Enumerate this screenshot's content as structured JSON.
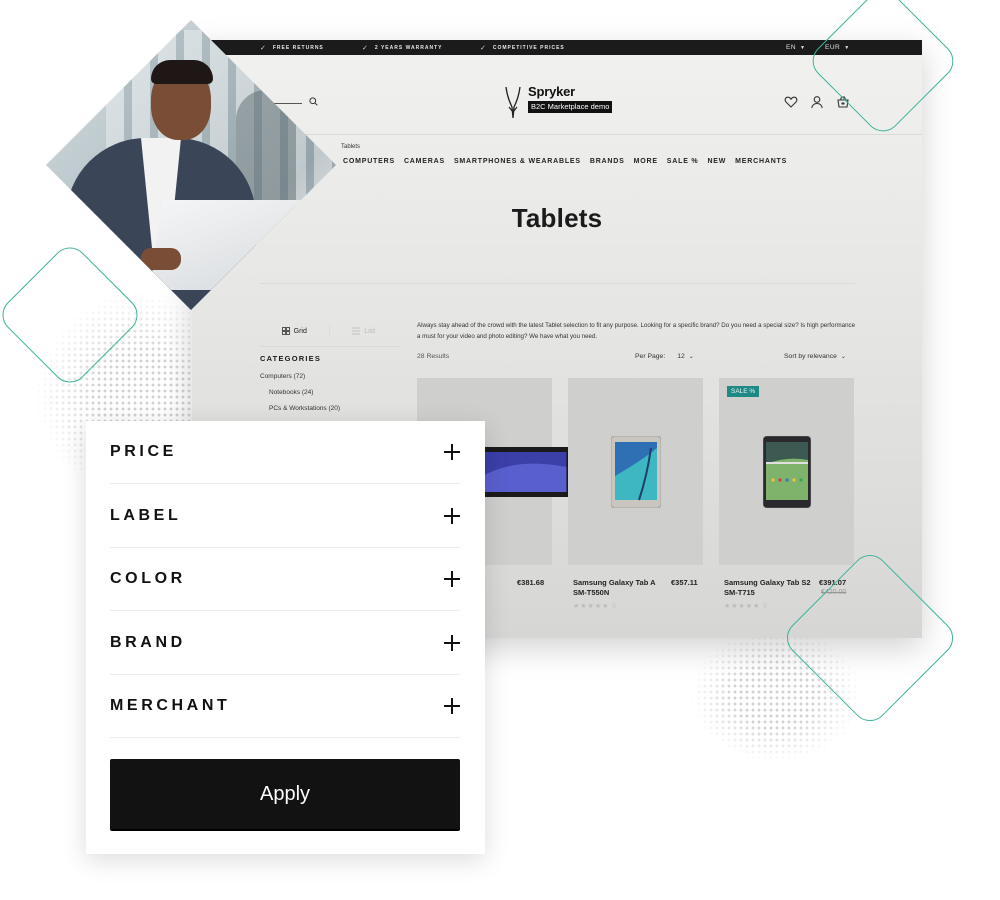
{
  "topbar": {
    "promos": [
      "Free Returns",
      "2 Years Warranty",
      "Competitive Prices"
    ],
    "language": "EN",
    "currency": "EUR"
  },
  "header": {
    "brand_name": "Spryker",
    "brand_subtitle": "B2C Marketplace demo",
    "icons": [
      "search-icon",
      "heart-icon",
      "user-icon",
      "cart-icon"
    ]
  },
  "nav": {
    "items": [
      "Computers",
      "Cameras",
      "Smartphones & Wearables",
      "Brands",
      "More",
      "Sale %",
      "New",
      "Merchants"
    ]
  },
  "breadcrumb": {
    "current": "Tablets"
  },
  "page": {
    "title": "Tablets",
    "description": "Always stay ahead of the crowd with the latest Tablet selection to fit any purpose. Looking for a specific brand? Do you need a special size? Is high performance a must for your video and photo editing? We have what you need.",
    "results": "28 Results",
    "per_page_label": "Per Page:",
    "per_page_value": "12",
    "sort_label": "Sort by relevance"
  },
  "view_toggle": {
    "grid": "Grid",
    "list": "List"
  },
  "categories": {
    "title": "Categories",
    "items": [
      {
        "label": "Computers (72)",
        "level": 0
      },
      {
        "label": "Notebooks (24)",
        "level": 1
      },
      {
        "label": "PCs & Workstations (20)",
        "level": 1
      }
    ]
  },
  "products": [
    {
      "name": "",
      "price": "€381.68",
      "old_price": "",
      "badge": "",
      "rating": 0
    },
    {
      "name": "Samsung Galaxy Tab A SM-T550N",
      "price": "€357.11",
      "old_price": "",
      "badge": "",
      "rating": 0
    },
    {
      "name": "Samsung Galaxy Tab S2 SM-T715",
      "price": "€391.07",
      "old_price": "€420.00",
      "badge": "SALE %",
      "rating": 0
    }
  ],
  "filters": {
    "items": [
      "Price",
      "Label",
      "Color",
      "Brand",
      "Merchant"
    ],
    "apply_label": "Apply"
  },
  "colors": {
    "accent_teal": "#3db39a",
    "sale_badge": "#1f8a85",
    "dark": "#121212"
  }
}
